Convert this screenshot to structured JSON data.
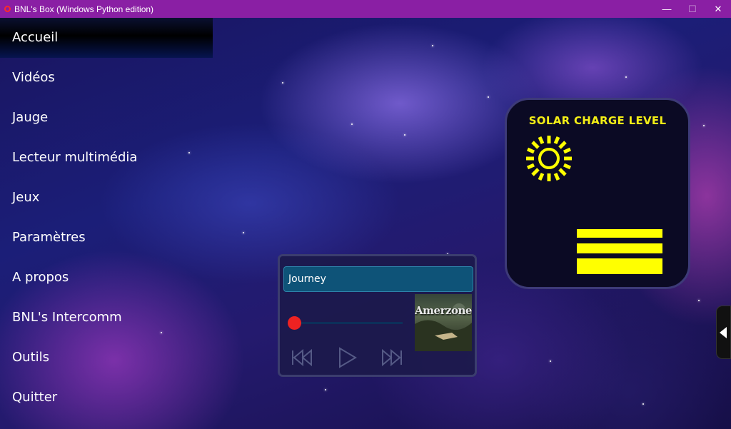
{
  "window": {
    "title": "BNL's Box (Windows Python edition)",
    "minimize_label": "—",
    "maximize_label": "☐",
    "close_label": "✕"
  },
  "sidebar": {
    "items": [
      {
        "label": "Accueil",
        "active": true
      },
      {
        "label": "Vidéos"
      },
      {
        "label": "Jauge"
      },
      {
        "label": "Lecteur multimédia"
      },
      {
        "label": "Jeux"
      },
      {
        "label": "Paramètres"
      },
      {
        "label": "A propos"
      },
      {
        "label": "BNL's Intercomm"
      },
      {
        "label": "Outils"
      },
      {
        "label": "Quitter"
      }
    ]
  },
  "solar_widget": {
    "title": "SOLAR CHARGE LEVEL",
    "icon": "sun-icon",
    "charge_bars": 3,
    "bar_color": "#ffff00",
    "title_color": "#f4ee16"
  },
  "media_player": {
    "track_title": "Journey",
    "progress": 0,
    "album_cover_text": "Amerzone",
    "controls": [
      "previous-icon",
      "play-icon",
      "next-icon"
    ],
    "knob_color": "#ee2222"
  },
  "colors": {
    "titlebar": "#8a1fa4",
    "accent": "#0e5378"
  }
}
